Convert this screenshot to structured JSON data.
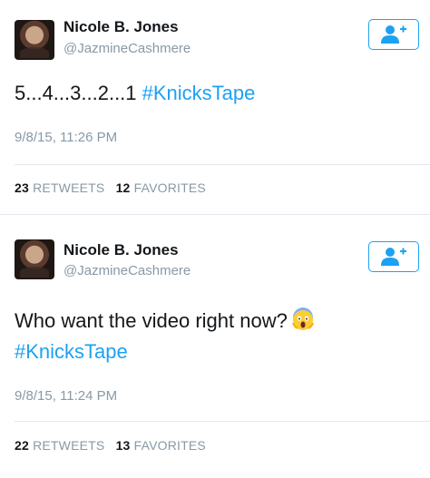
{
  "tweets": [
    {
      "name": "Nicole B. Jones",
      "handle": "@JazmineCashmere",
      "text_plain": "5...4...3...2...1 ",
      "hashtag": "#KnicksTape",
      "timestamp": "9/8/15, 11:26 PM",
      "retweets_count": "23",
      "retweets_label": "RETWEETS",
      "favorites_count": "12",
      "favorites_label": "FAVORITES"
    },
    {
      "name": "Nicole B. Jones",
      "handle": "@JazmineCashmere",
      "text_plain": "Who want the video right now?",
      "emoji": "face-screaming-in-fear",
      "hashtag": "#KnicksTape",
      "timestamp": "9/8/15, 11:24 PM",
      "retweets_count": "22",
      "retweets_label": "RETWEETS",
      "favorites_count": "13",
      "favorites_label": "FAVORITES"
    }
  ],
  "colors": {
    "accent": "#1da1f2",
    "muted": "#8899a6",
    "text": "#14171a",
    "divider": "#e1e8ed"
  },
  "icons": {
    "follow": "add-user-icon"
  }
}
